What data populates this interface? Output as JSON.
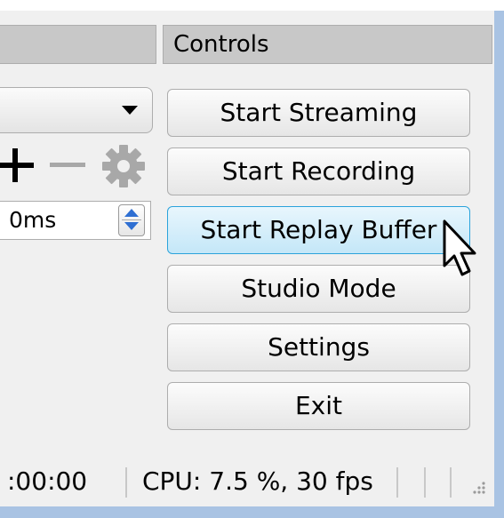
{
  "controls_dock": {
    "title": "Controls",
    "buttons": [
      {
        "id": "start-streaming",
        "label": "Start Streaming"
      },
      {
        "id": "start-recording",
        "label": "Start Recording"
      },
      {
        "id": "start-replay-buffer",
        "label": "Start Replay Buffer",
        "state": "hover"
      },
      {
        "id": "studio-mode",
        "label": "Studio Mode"
      },
      {
        "id": "settings",
        "label": "Settings"
      },
      {
        "id": "exit",
        "label": "Exit"
      }
    ]
  },
  "left_panel": {
    "dock_title": "",
    "spin_value": "0ms",
    "toolbar_icons": [
      "add-icon",
      "remove-icon",
      "gear-icon"
    ]
  },
  "status_bar": {
    "time": ":00:00",
    "cpu": "CPU: 7.5 %, 30 fps"
  },
  "colors": {
    "hover_border": "#2ba3db",
    "hover_fill": "#c4e7f8",
    "window_frame": "#a9c3e3",
    "spin_arrow": "#2f6fd2",
    "icon_gray": "#a8a8a8"
  }
}
